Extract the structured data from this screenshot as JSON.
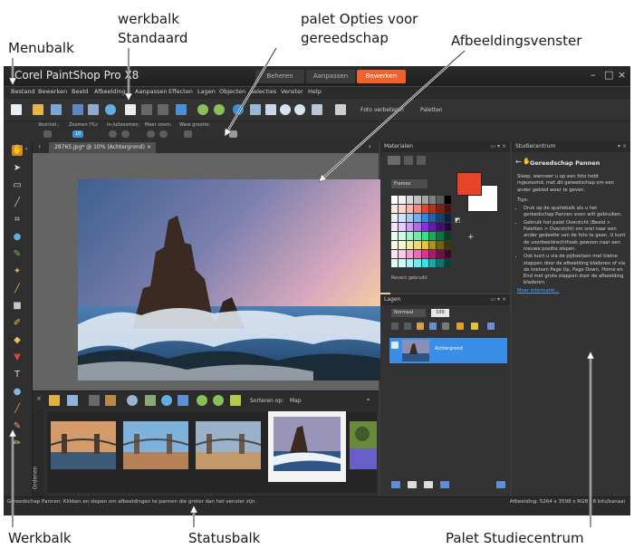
{
  "callouts": {
    "menubalk": "Menubalk",
    "werkbalk_standaard_line1": "werkbalk",
    "werkbalk_standaard_line2": "Standaard",
    "palet_opties_line1": "palet Opties voor",
    "palet_opties_line2": "gereedschap",
    "afbeeldingsvenster": "Afbeeldingsvenster",
    "werkbalk": "Werkbalk",
    "statusbalk": "Statusbalk",
    "palet_studiecentrum": "Palet Studiecentrum"
  },
  "app": {
    "title": "Corel PaintShop Pro X8",
    "workspace_tabs": [
      "Beheren",
      "Aanpassen",
      "Bewerken"
    ],
    "active_tab_index": 2,
    "window_controls": [
      "–",
      "□",
      "×"
    ]
  },
  "menubar": {
    "items": [
      "Bestand",
      "Bewerken",
      "Beeld",
      "Afbeelding",
      "Aanpassen",
      "Effecten",
      "Lagen",
      "Objecten",
      "Selecties",
      "Venster",
      "Help"
    ]
  },
  "standard_toolbar": {
    "enhance_label": "Foto verbeteren",
    "palettes_label": "Paletten"
  },
  "tool_options": {
    "labels": [
      "Voorinst.:",
      "Zoomen (%):",
      "In-/uitzoomen:",
      "Meer zoom:",
      "Ware grootte:"
    ],
    "zoom_value": "10"
  },
  "document": {
    "tab_label": "28765.jpg* @ 10% (Achtergrond)",
    "close": "×"
  },
  "organizer": {
    "sort_label": "Sorteren op:",
    "sort_value": "Map",
    "vertical_label": "Ordenen"
  },
  "materials_panel": {
    "title": "Materialen",
    "dropdown": "Frames",
    "recent_label": "Recent gebruikt",
    "fg_color": "#e8442a",
    "bg_color": "#ffffff",
    "swatches": [
      "#ffffff",
      "#f2f2f2",
      "#d9d9d9",
      "#bfbfbf",
      "#a6a6a6",
      "#808080",
      "#595959",
      "#000000",
      "#fde9e7",
      "#fcd5cf",
      "#f9b7ad",
      "#f28b7b",
      "#e8442a",
      "#b5311c",
      "#80200f",
      "#4d1207",
      "#e7f2fd",
      "#cde4fb",
      "#a3cdf7",
      "#6fb1f2",
      "#2f8ae6",
      "#1f62ab",
      "#144073",
      "#0a2342",
      "#f4e7fd",
      "#e6cbfb",
      "#cf9df5",
      "#b06cee",
      "#8a2fe6",
      "#6419ab",
      "#410f73",
      "#220742",
      "#e7fdf2",
      "#cbfbe2",
      "#9df5c8",
      "#6ceeaa",
      "#2fe680",
      "#19ab5c",
      "#0f733d",
      "#07421f",
      "#fdfae7",
      "#fbf3cb",
      "#f5e89d",
      "#eed96c",
      "#e6c72f",
      "#ab9219",
      "#73610f",
      "#423607",
      "#fde7f4",
      "#fbcbe6",
      "#f59dd0",
      "#ee6cb6",
      "#e62f94",
      "#ab196b",
      "#730f47",
      "#420726",
      "#e7fdfd",
      "#cbfbfb",
      "#9df5f5",
      "#6ceeee",
      "#2fe6e6",
      "#19abab",
      "#0f7373",
      "#074242"
    ]
  },
  "layers_panel": {
    "title": "Lagen",
    "blend_mode": "Normaal",
    "opacity": "100",
    "layer_name": "Achtergrond"
  },
  "learning_center": {
    "title": "Studiecentrum",
    "heading": "Gereedschap Pannen",
    "intro": "Sleep, wanneer u op een foto hebt ingezoomd, met dit gereedschap om een ander gebied weer te geven.",
    "tips_label": "Tips:",
    "tips": [
      "Druk op de spatiebalk als u het gereedschap Pannen even wilt gebruiken.",
      "Gebruik het palet Overzicht (Beeld > Paletten > Overzicht) om snel naar een ander gedeelte van de foto te gaan. U kunt de voorbeeldrechthoek gewoon naar een nieuwe positie slepen.",
      "Ook kunt u via de pijltoetsen met kleine stappen door de afbeelding bladeren of via de toetsen Page Up, Page Down, Home en End met grote stappen door de afbeelding bladeren."
    ],
    "more_link": "Meer informatie..."
  },
  "statusbar": {
    "text": "Gereedschap Pannen: Klikken en slepen om afbeeldingen te pannen die groter dan het venster zijn.",
    "info": "Afbeelding: 5264 x 3598 x RGB - 8 bits/kanaal"
  }
}
